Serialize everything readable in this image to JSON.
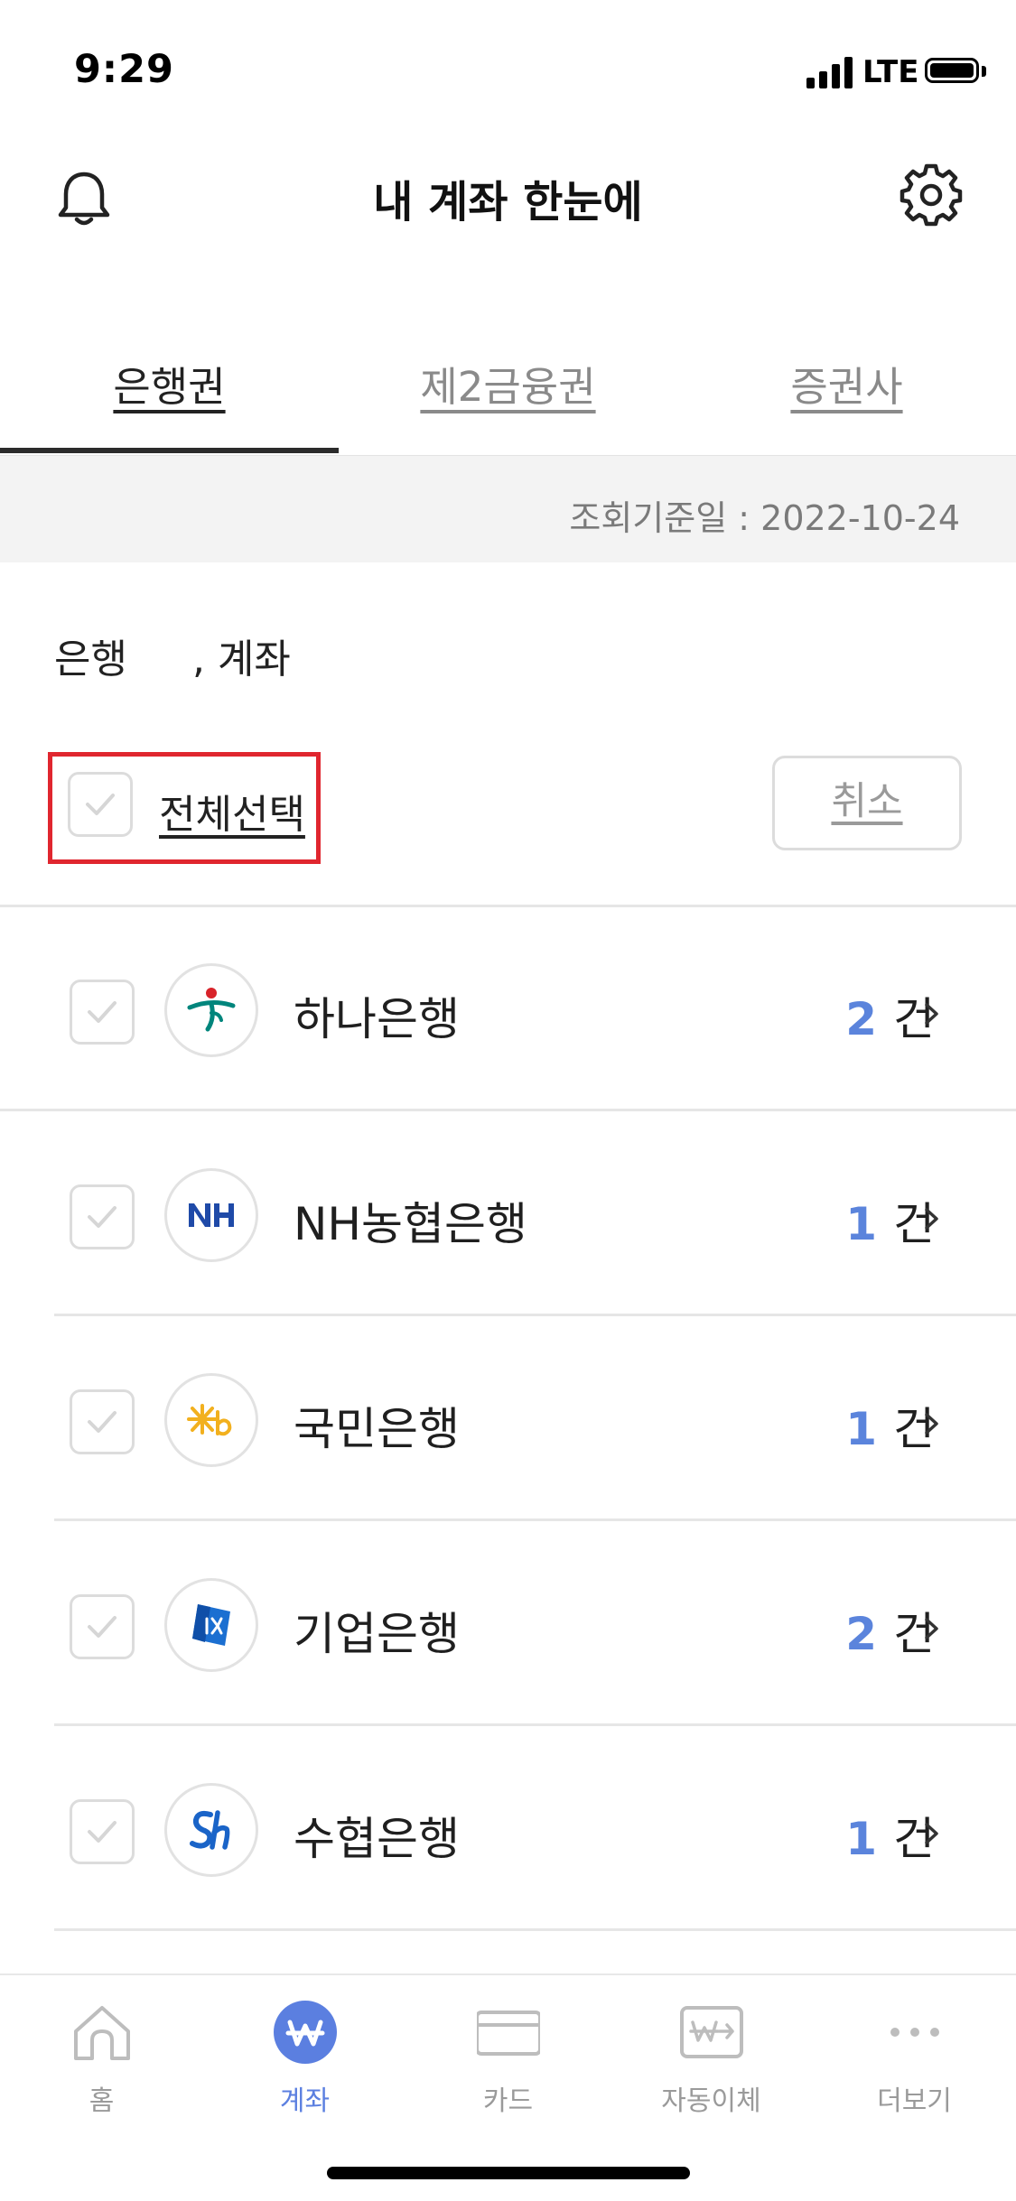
{
  "status_bar": {
    "time": "9:29",
    "network": "LTE"
  },
  "header": {
    "title": "내 계좌 한눈에"
  },
  "tabs": [
    {
      "label": "은행권",
      "active": true
    },
    {
      "label": "제2금융권",
      "active": false
    },
    {
      "label": "증권사",
      "active": false
    }
  ],
  "date_bar": {
    "text": "조회기준일 : 2022-10-24"
  },
  "summary": {
    "banks_label": "은행",
    "accounts_label": ", 계좌"
  },
  "select_all": {
    "label": "전체선택",
    "checked": false
  },
  "cancel_button": {
    "label": "취소"
  },
  "banks": [
    {
      "name": "하나은행",
      "count": "2",
      "unit": "건",
      "logo": "hana-bank-logo"
    },
    {
      "name": "NH농협은행",
      "count": "1",
      "unit": "건",
      "logo": "nh-bank-logo"
    },
    {
      "name": "국민은행",
      "count": "1",
      "unit": "건",
      "logo": "kb-bank-logo"
    },
    {
      "name": "기업은행",
      "count": "2",
      "unit": "건",
      "logo": "ibk-bank-logo"
    },
    {
      "name": "수협은행",
      "count": "1",
      "unit": "건",
      "logo": "sh-bank-logo"
    }
  ],
  "bottom_nav": [
    {
      "label": "홈",
      "icon": "home-icon",
      "active": false
    },
    {
      "label": "계좌",
      "icon": "won-icon",
      "active": true
    },
    {
      "label": "카드",
      "icon": "card-icon",
      "active": false
    },
    {
      "label": "자동이체",
      "icon": "auto-transfer-icon",
      "active": false
    },
    {
      "label": "더보기",
      "icon": "more-icon",
      "active": false
    }
  ],
  "colors": {
    "accent": "#5b84dc",
    "nav_active": "#5b7fe0",
    "highlight_box": "#e0262f"
  }
}
